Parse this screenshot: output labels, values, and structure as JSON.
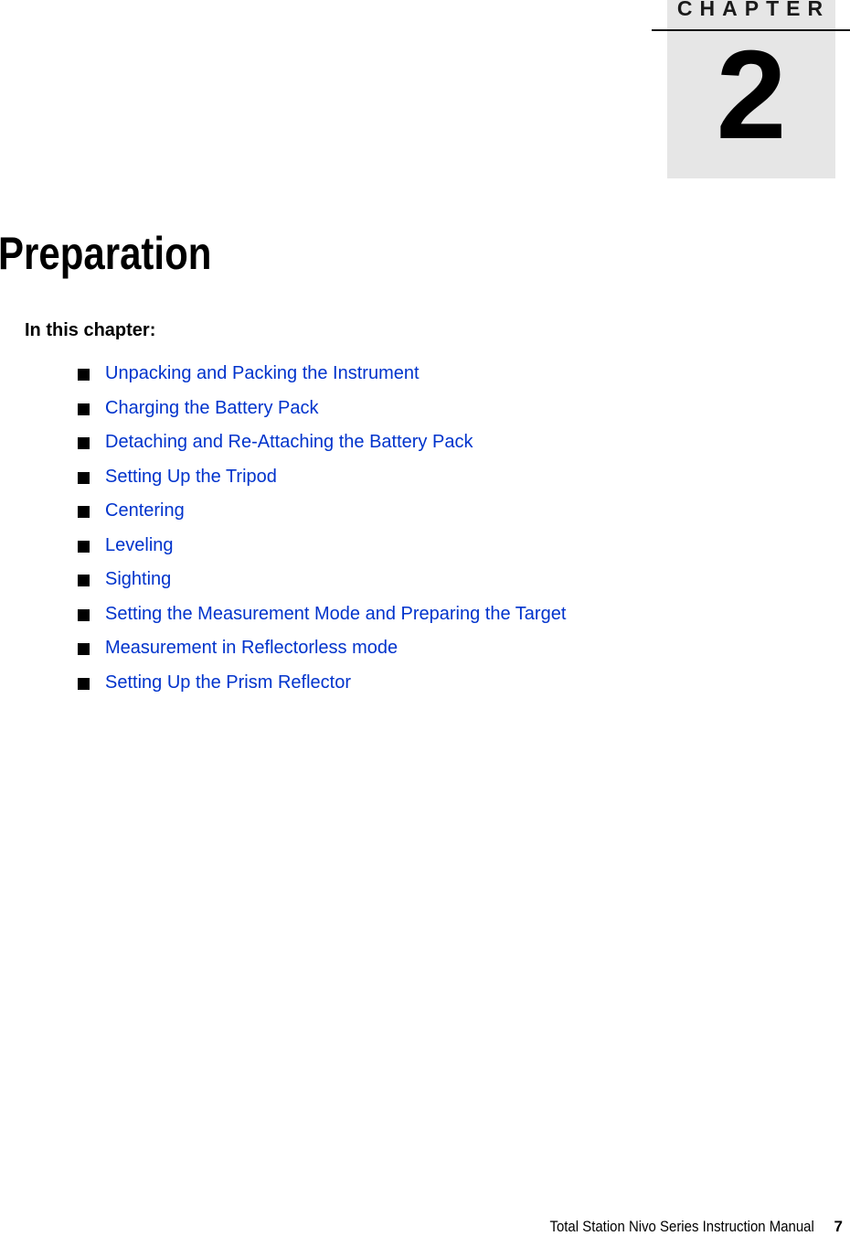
{
  "chapter": {
    "label": "CHAPTER",
    "number": "2",
    "box_color": "#e6e6e6"
  },
  "page_title": "Preparation",
  "intro_heading": "In this chapter:",
  "link_color": "#0033cc",
  "toc": [
    {
      "label": "Unpacking and Packing the Instrument"
    },
    {
      "label": "Charging the Battery Pack"
    },
    {
      "label": "Detaching and Re-Attaching the Battery Pack"
    },
    {
      "label": "Setting Up the Tripod"
    },
    {
      "label": "Centering"
    },
    {
      "label": "Leveling"
    },
    {
      "label": "Sighting"
    },
    {
      "label": "Setting the Measurement Mode and Preparing the Target"
    },
    {
      "label": "Measurement in Reflectorless mode"
    },
    {
      "label": "Setting Up the Prism Reflector"
    }
  ],
  "footer": {
    "manual_title": "Total Station Nivo Series Instruction Manual",
    "page_number": "7"
  }
}
